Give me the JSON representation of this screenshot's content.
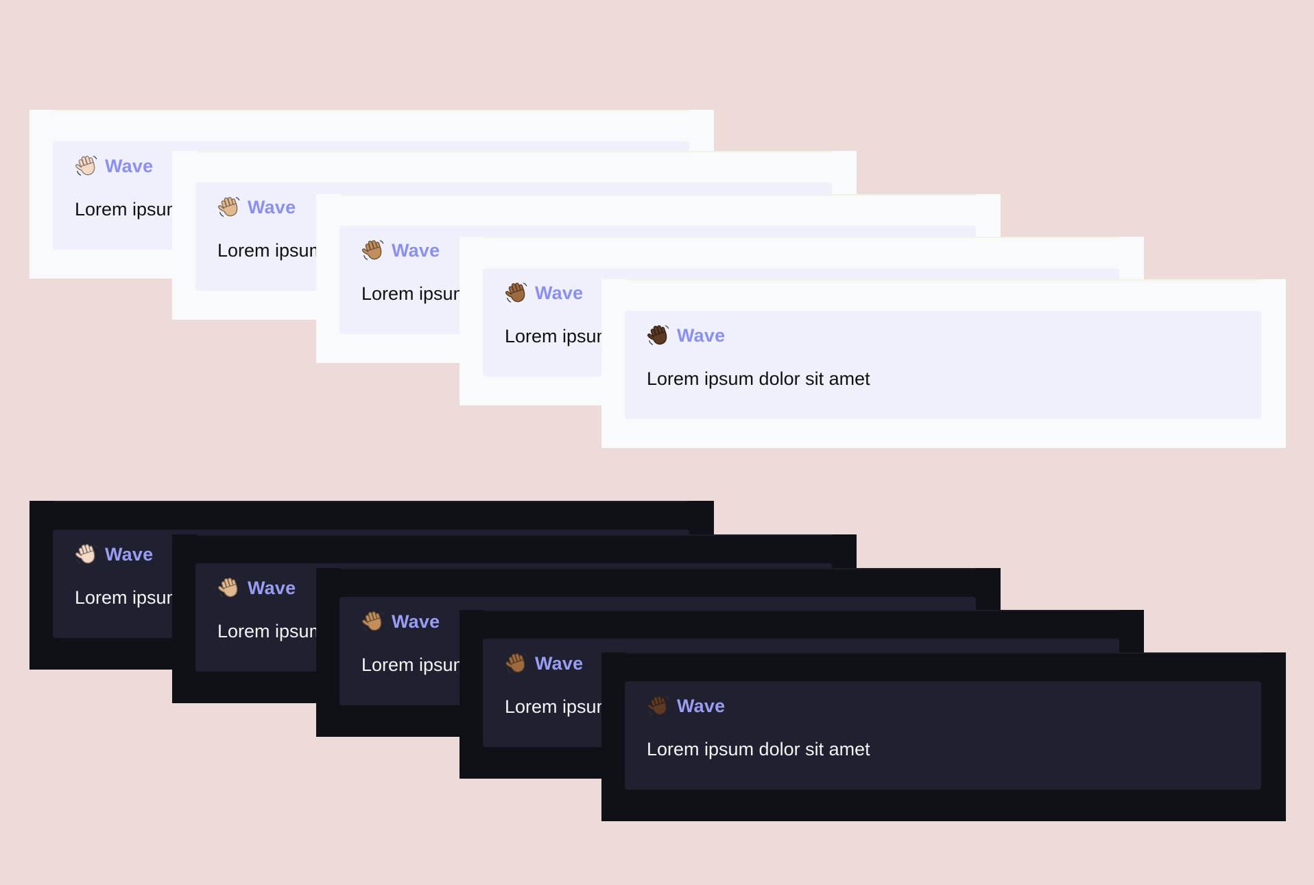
{
  "light_cards": [
    {
      "title": "Wave",
      "body": "Lorem ipsum dolor sit amet",
      "icon": "waving-hand-light-skin-tone-icon",
      "skin": "#f4dac6"
    },
    {
      "title": "Wave",
      "body": "Lorem ipsum dolor sit amet",
      "icon": "waving-hand-medium-light-skin-tone-icon",
      "skin": "#e2b98f"
    },
    {
      "title": "Wave",
      "body": "Lorem ipsum dolor sit amet",
      "icon": "waving-hand-medium-skin-tone-icon",
      "skin": "#c28f5c"
    },
    {
      "title": "Wave",
      "body": "Lorem ipsum dolor sit amet",
      "icon": "waving-hand-medium-dark-skin-tone-icon",
      "skin": "#9c6a3e"
    },
    {
      "title": "Wave",
      "body": "Lorem ipsum dolor sit amet",
      "icon": "waving-hand-dark-skin-tone-icon",
      "skin": "#5c3a24"
    }
  ],
  "dark_cards": [
    {
      "title": "Wave",
      "body": "Lorem ipsum dolor sit amet",
      "icon": "waving-hand-light-skin-tone-icon",
      "skin": "#f4dac6"
    },
    {
      "title": "Wave",
      "body": "Lorem ipsum dolor sit amet",
      "icon": "waving-hand-medium-light-skin-tone-icon",
      "skin": "#e2b98f"
    },
    {
      "title": "Wave",
      "body": "Lorem ipsum dolor sit amet",
      "icon": "waving-hand-medium-skin-tone-icon",
      "skin": "#c28f5c"
    },
    {
      "title": "Wave",
      "body": "Lorem ipsum dolor sit amet",
      "icon": "waving-hand-medium-dark-skin-tone-icon",
      "skin": "#9c6a3e"
    },
    {
      "title": "Wave",
      "body": "Lorem ipsum dolor sit amet",
      "icon": "waving-hand-dark-skin-tone-icon",
      "skin": "#5c3a24"
    }
  ],
  "colors": {
    "background": "#ecdbd9",
    "light_frame": "#f8fafc",
    "light_card": "#eef0fb",
    "dark_frame": "#0f1116",
    "dark_card": "#1f2030",
    "accent": "#8b8ff0"
  }
}
